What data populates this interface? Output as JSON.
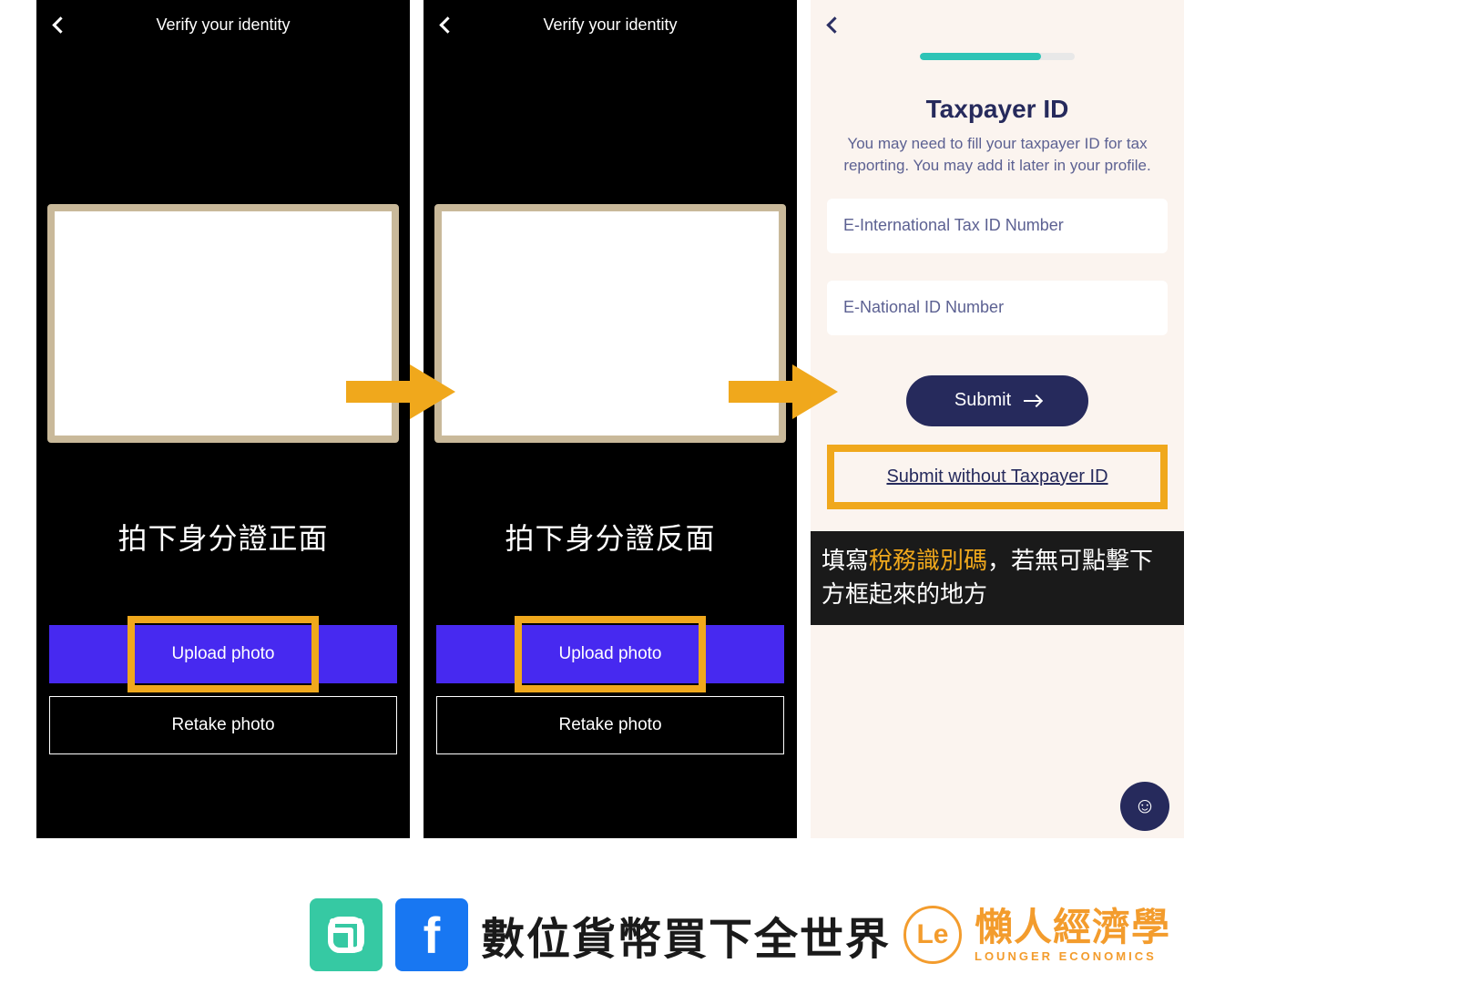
{
  "screens": {
    "verify1": {
      "title": "Verify your identity",
      "caption": "拍下身分證正面",
      "upload_label": "Upload photo",
      "retake_label": "Retake photo"
    },
    "verify2": {
      "title": "Verify your identity",
      "caption": "拍下身分證反面",
      "upload_label": "Upload photo",
      "retake_label": "Retake photo"
    },
    "taxpayer": {
      "title": "Taxpayer ID",
      "desc": "You may need to fill your taxpayer ID for tax reporting. You may add it later in your profile.",
      "input1_placeholder": "E-International Tax ID Number",
      "input2_placeholder": "E-National ID Number",
      "submit_label": "Submit",
      "submit_without_label": "Submit without Taxpayer ID",
      "tip_prefix": "填寫",
      "tip_highlight": "稅務識別碼",
      "tip_suffix": "，若無可點擊下方框起來的地方"
    }
  },
  "footer": {
    "text1": "數位貨幣買下全世界",
    "brand_main": "懶人經濟學",
    "brand_sub": "LOUNGER ECONOMICS"
  },
  "colors": {
    "accent_orange": "#f0a81c",
    "primary_blue": "#4729f0",
    "navy": "#262a5c",
    "teal": "#2ec4b6"
  }
}
